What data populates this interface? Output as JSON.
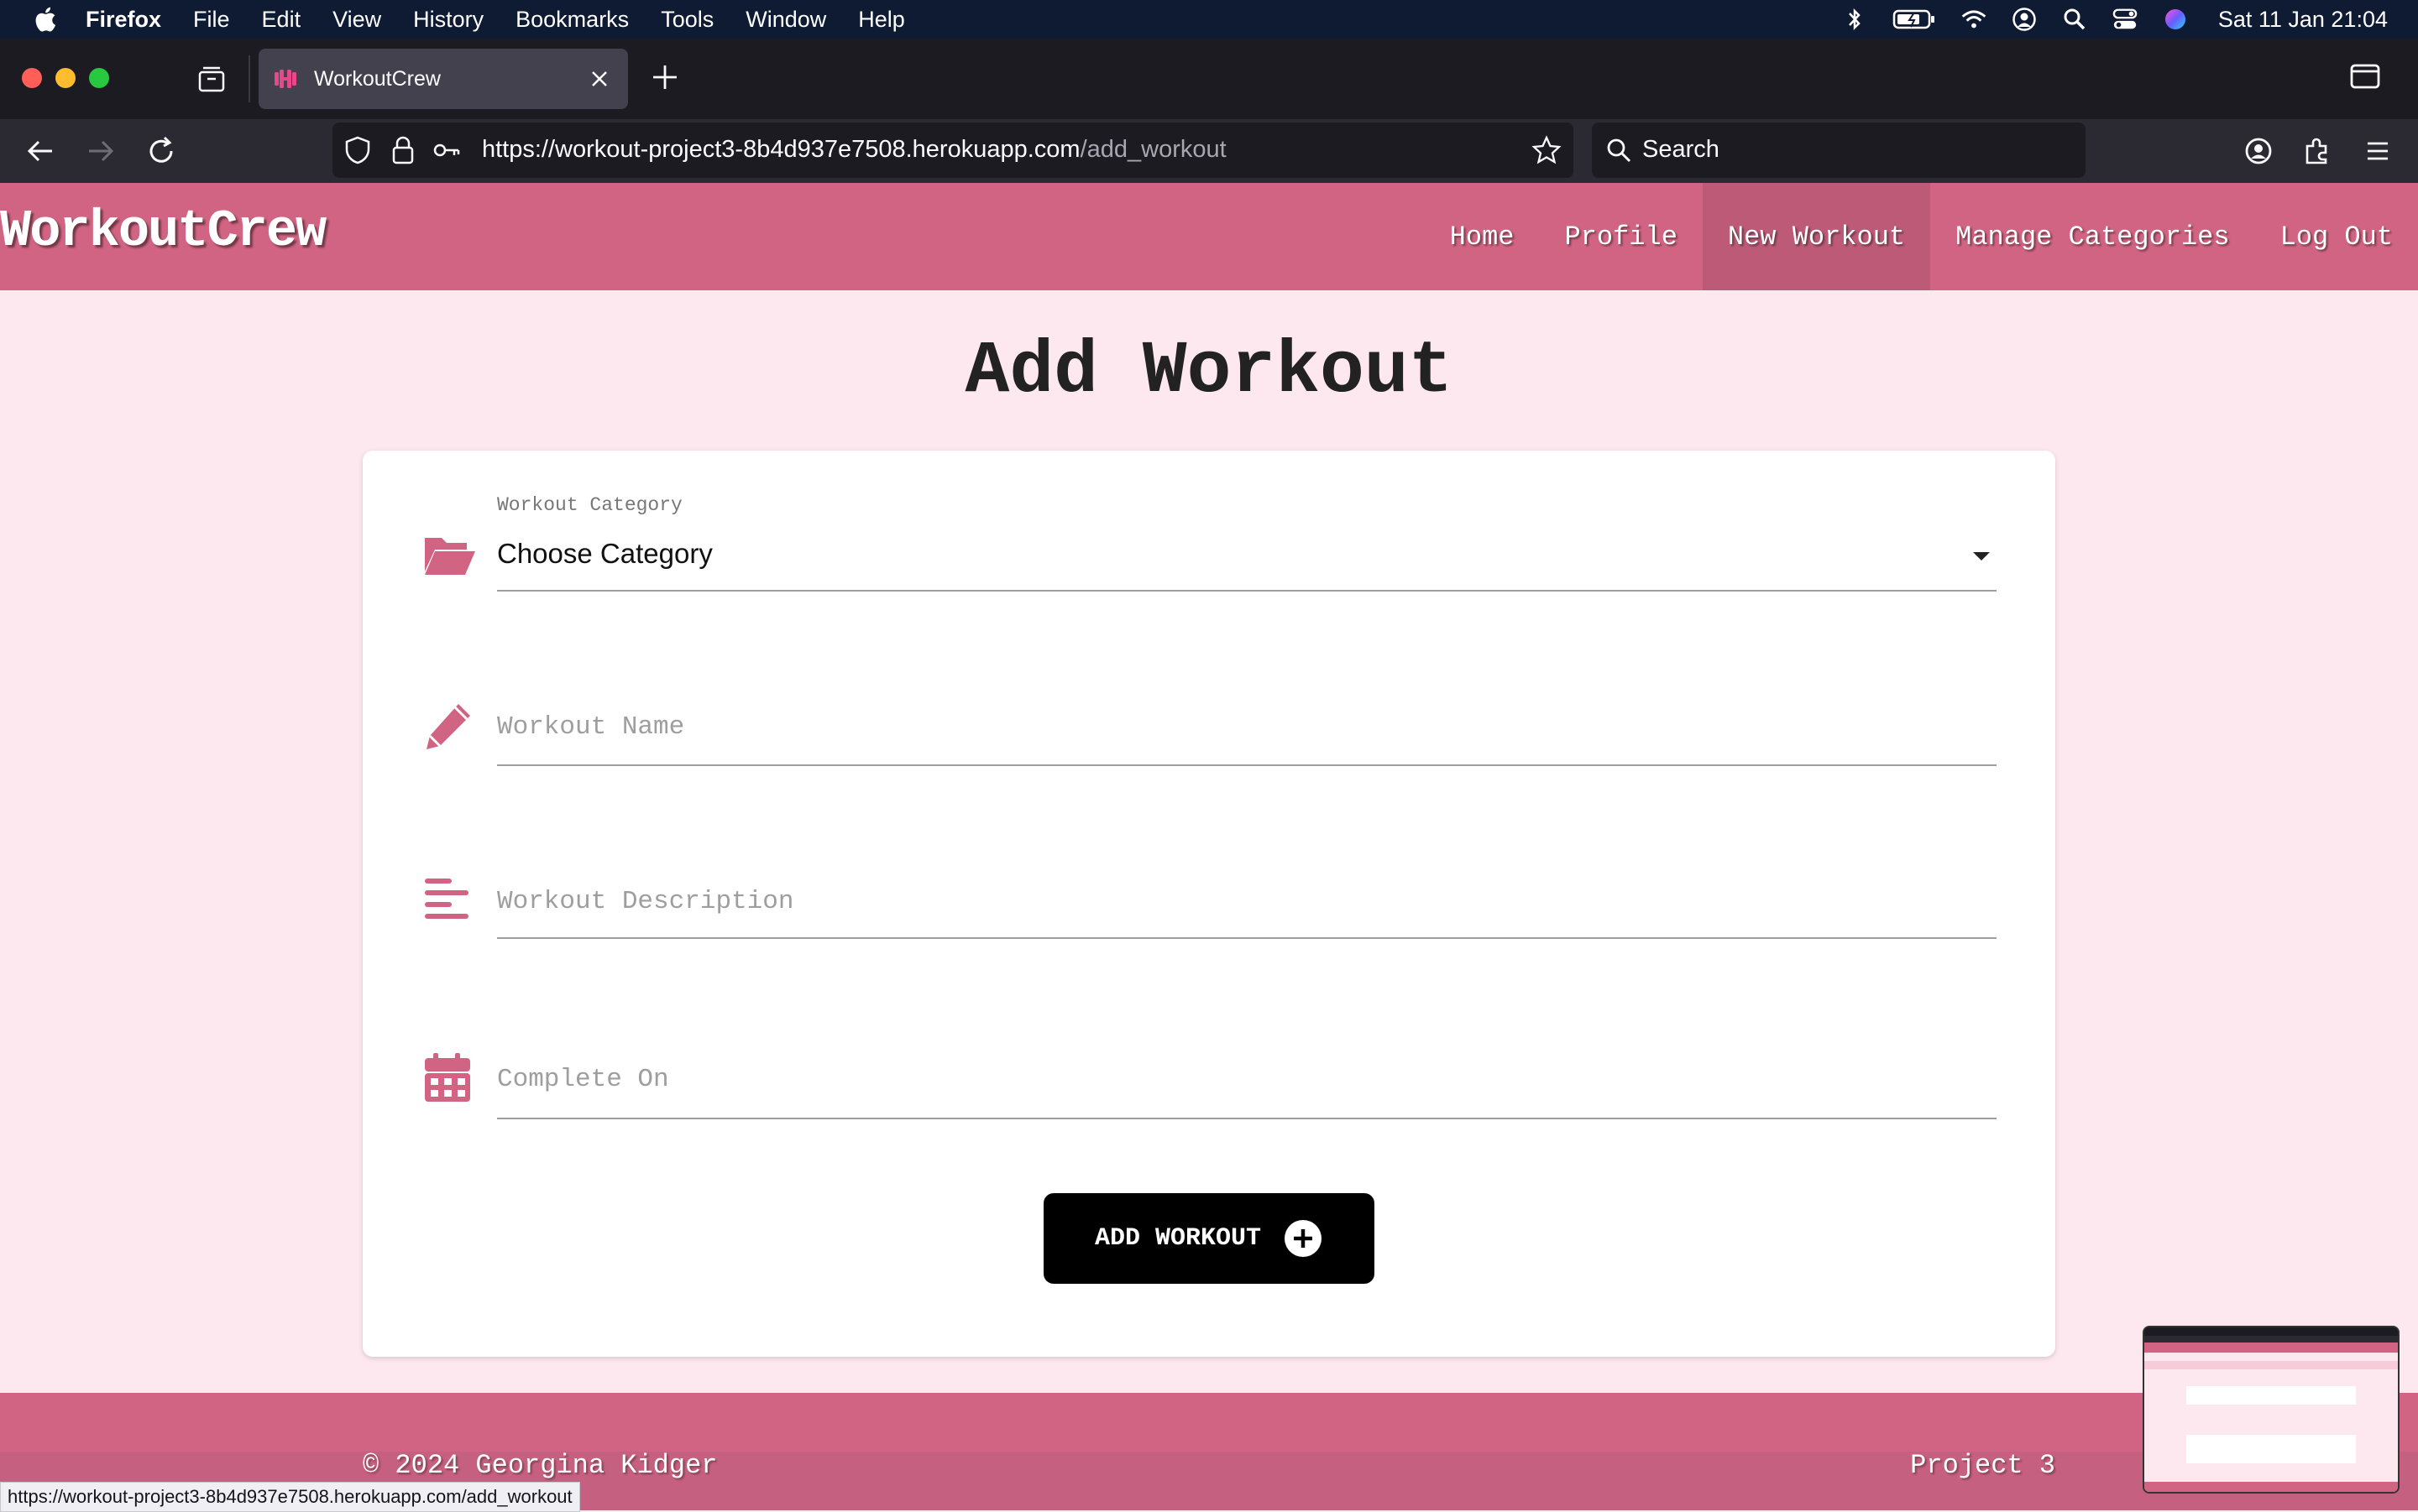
{
  "menubar": {
    "items": [
      "Firefox",
      "File",
      "Edit",
      "View",
      "History",
      "Bookmarks",
      "Tools",
      "Window",
      "Help"
    ],
    "clock": "Sat 11 Jan  21:04"
  },
  "browser": {
    "tab_title": "WorkoutCrew",
    "url_main": "https://workout-project3-8b4d937e7508.herokuapp.com",
    "url_path": "/add_workout",
    "search_placeholder": "Search",
    "status_url": "https://workout-project3-8b4d937e7508.herokuapp.com/add_workout"
  },
  "site": {
    "brand": "WorkoutCrew",
    "nav": [
      "Home",
      "Profile",
      "New Workout",
      "Manage Categories",
      "Log Out"
    ],
    "active_nav": "New Workout"
  },
  "form": {
    "title": "Add Workout",
    "category_label": "Workout Category",
    "category_value": "Choose Category",
    "name_placeholder": "Workout Name",
    "description_placeholder": "Workout Description",
    "complete_placeholder": "Complete On",
    "submit_label": "ADD WORKOUT"
  },
  "footer": {
    "copyright": "© 2024 Georgina Kidger",
    "project": "Project 3"
  },
  "colors": {
    "brand_pink": "#d06482",
    "page_bg": "#fce8ee",
    "icon_pink": "#d06482"
  }
}
